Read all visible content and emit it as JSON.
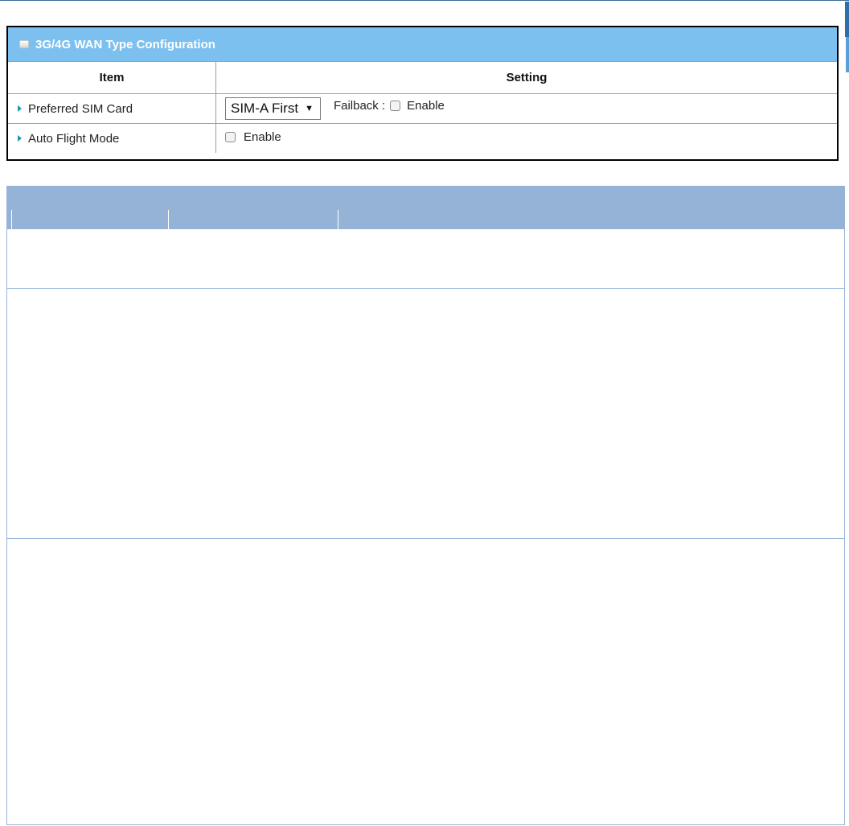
{
  "config_panel": {
    "title": "3G/4G WAN Type Configuration",
    "header_icon": "panel-toggle-icon",
    "columns": {
      "item": "Item",
      "setting": "Setting"
    },
    "rows": {
      "preferred_sim": {
        "label": "Preferred SIM Card",
        "select_value": "SIM-A First",
        "failback_label": "Failback :",
        "failback_checked": false,
        "failback_enable_label": "Enable"
      },
      "auto_flight": {
        "label": "Auto Flight Mode",
        "checked": false,
        "enable_label": "Enable"
      }
    }
  },
  "colors": {
    "panel_header": "#7cc0ef",
    "arrow": "#1a9aa6",
    "desc_header": "#95b3d7"
  }
}
